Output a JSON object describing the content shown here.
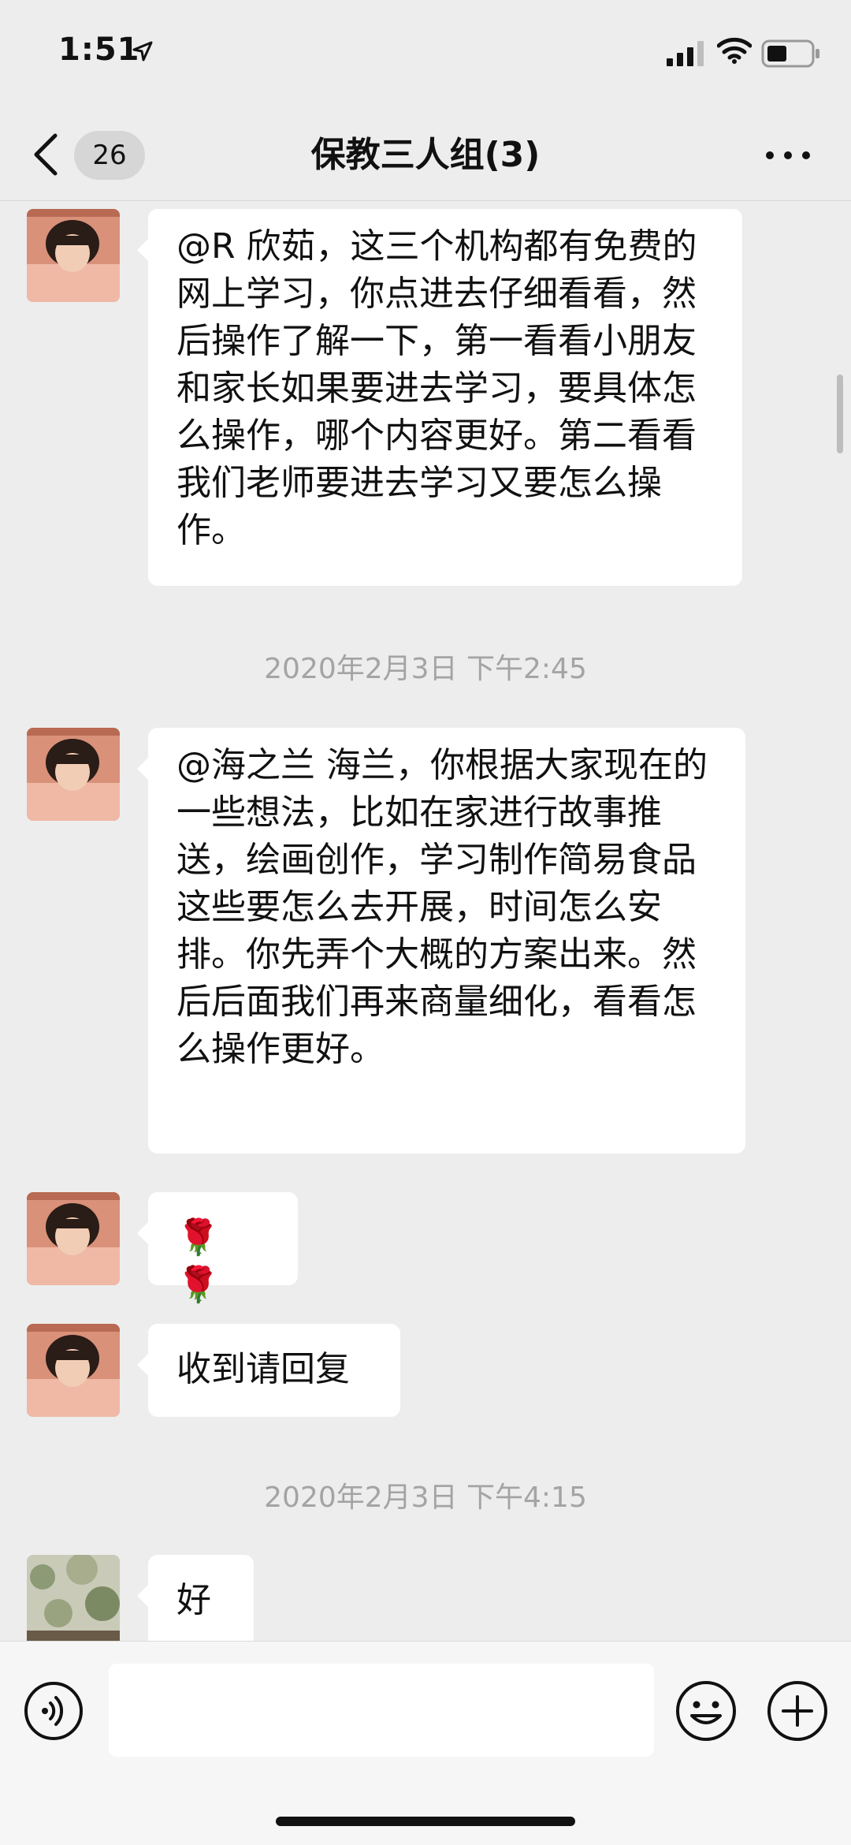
{
  "status_bar": {
    "time": "1:51"
  },
  "nav": {
    "unread_count": "26",
    "title": "保教三人组(3)"
  },
  "messages": [
    {
      "text": "@R 欣茹，这三个机构都有免费的网上学习，你点进去仔细看看，然后操作了解一下，第一看看小朋友和家长如果要进去学习，要具体怎么操作，哪个内容更好。第二看看我们老师要进去学习又要怎么操作。"
    },
    {
      "text": "@海之兰 海兰，你根据大家现在的一些想法，比如在家进行故事推送，绘画创作，学习制作简易食品这些要怎么去开展，时间怎么安排。你先弄个大概的方案出来。然后后面我们再来商量细化，看看怎么操作更好。"
    },
    {
      "text": "🌹 🌹"
    },
    {
      "text": "收到请回复"
    },
    {
      "text": "好"
    }
  ],
  "timestamps": [
    "2020年2月3日 下午2:45",
    "2020年2月3日 下午4:15"
  ],
  "icons": {
    "back": "chevron-left-icon",
    "more": "more-dots-icon",
    "voice": "voice-icon",
    "emoji": "emoji-icon",
    "plus": "plus-icon"
  },
  "colors": {
    "background": "#ededed",
    "bubble": "#ffffff",
    "timestamp": "#a4a4a4"
  }
}
